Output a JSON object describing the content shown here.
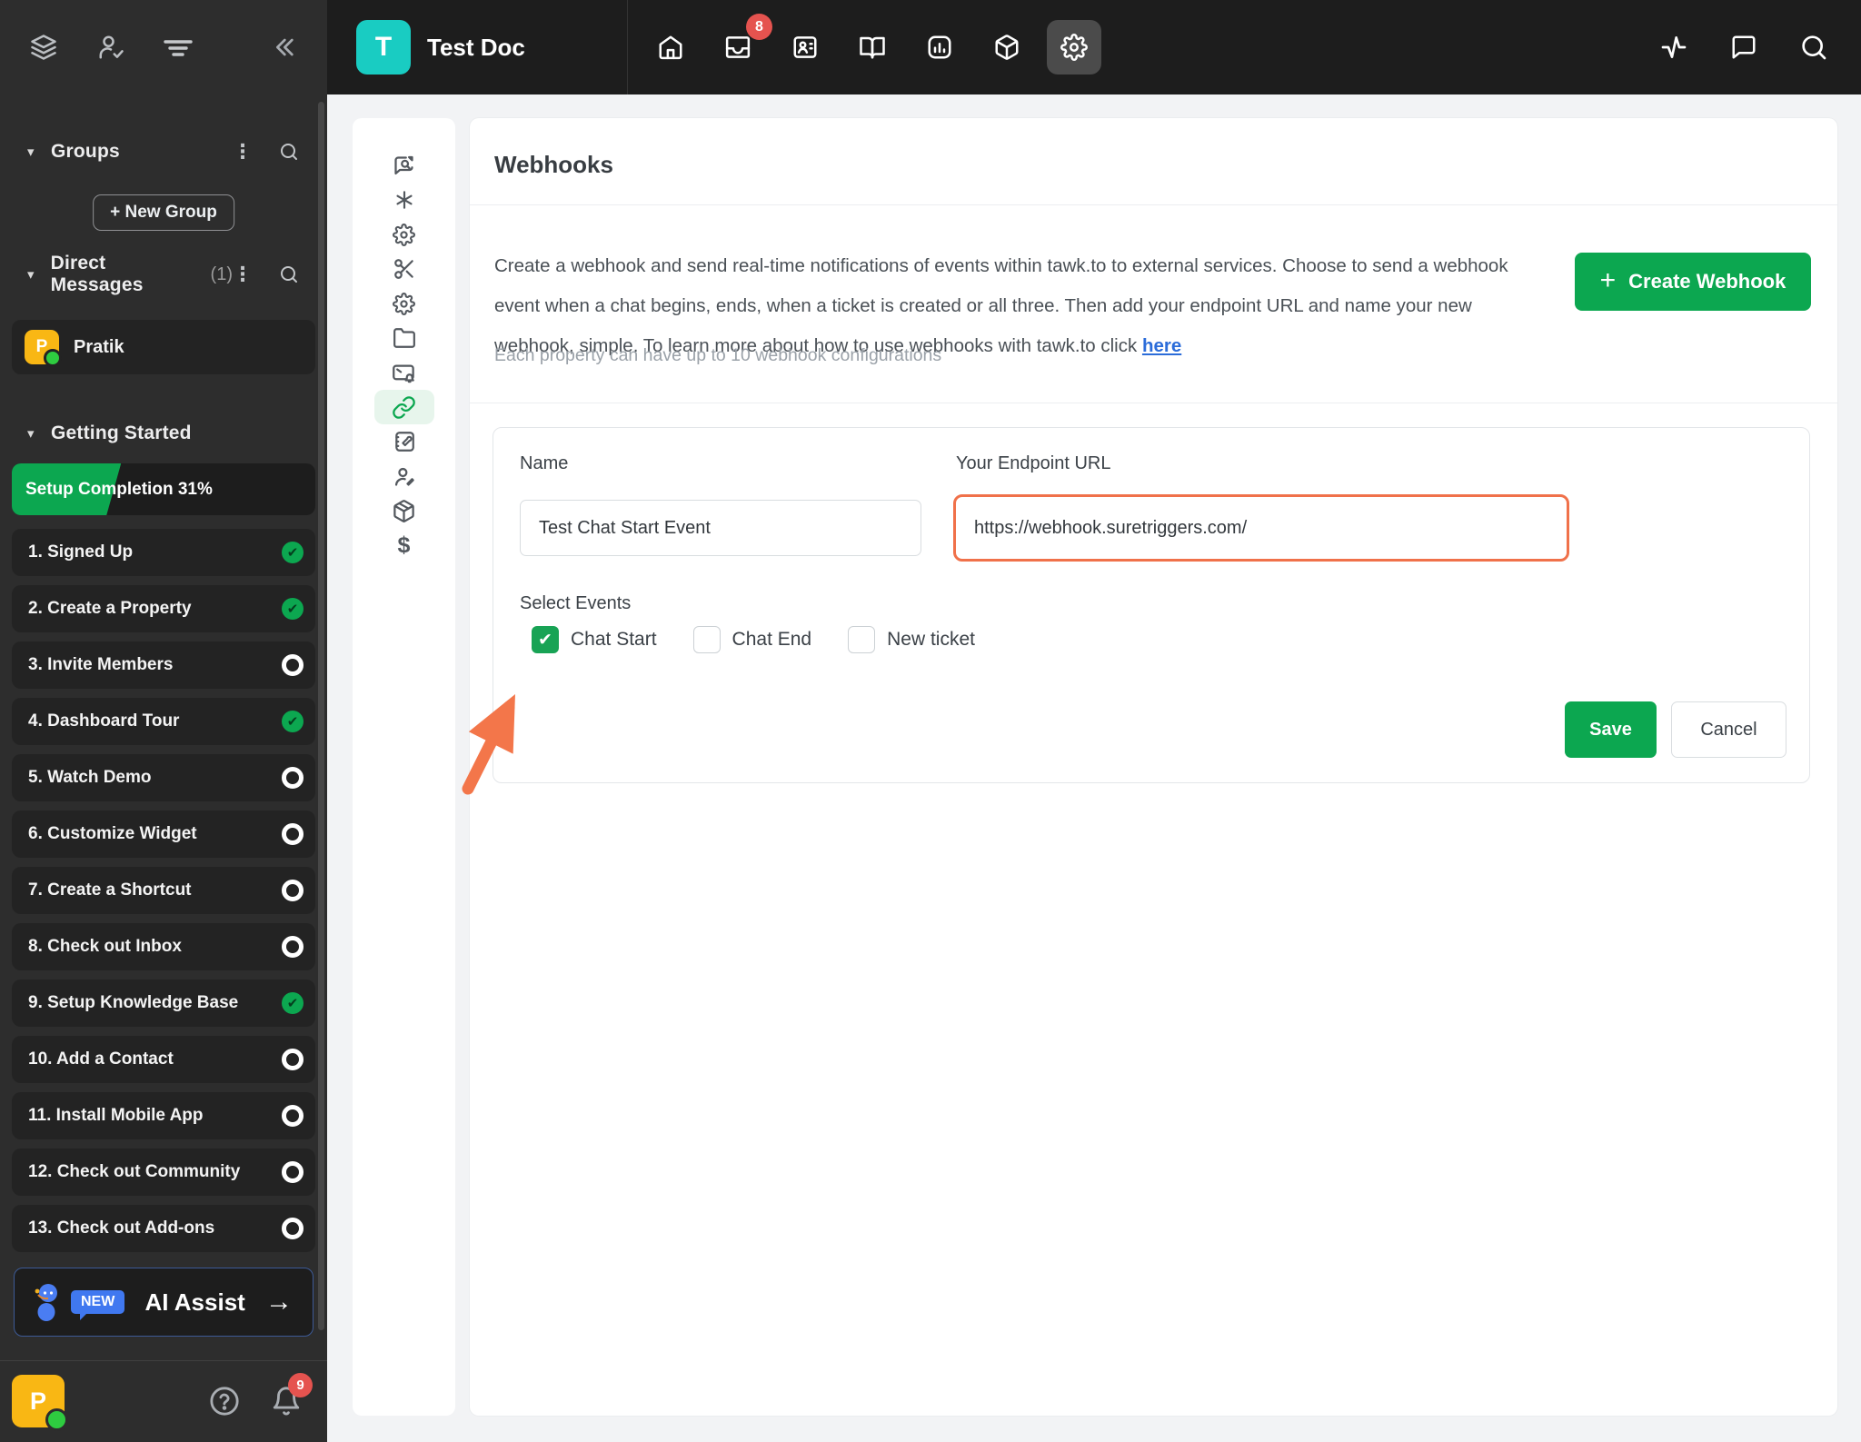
{
  "colors": {
    "accent_green": "#0CA750",
    "teal_brand": "#19CCC2",
    "highlight_orange": "#F0714A",
    "link_blue": "#2B6CD9",
    "badge_red": "#E5534F",
    "new_badge_blue": "#4078F0",
    "avatar_yellow": "#F9B714",
    "sidebar_bg": "#2D2D2D",
    "topbar_bg": "#1D1D1D"
  },
  "sidebar": {
    "header_icons": [
      "layers",
      "agent-check",
      "filter",
      "collapse-double-chevron"
    ],
    "groups": {
      "label": "Groups"
    },
    "new_group_label": "+ New Group",
    "direct_messages": {
      "label": "Direct Messages",
      "count": "(1)"
    },
    "dm_user": {
      "initial": "P",
      "name": "Pratik",
      "status": "online"
    },
    "getting_started": {
      "label": "Getting Started",
      "progress_label": "Setup Completion 31%",
      "progress_pct": 36,
      "items": [
        {
          "label": "1. Signed Up",
          "done": true
        },
        {
          "label": "2. Create a Property",
          "done": true
        },
        {
          "label": "3. Invite Members",
          "done": false
        },
        {
          "label": "4. Dashboard Tour",
          "done": true
        },
        {
          "label": "5. Watch Demo",
          "done": false
        },
        {
          "label": "6. Customize Widget",
          "done": false
        },
        {
          "label": "7. Create a Shortcut",
          "done": false
        },
        {
          "label": "8. Check out Inbox",
          "done": false
        },
        {
          "label": "9. Setup Knowledge Base",
          "done": true
        },
        {
          "label": "10. Add a Contact",
          "done": false
        },
        {
          "label": "11. Install Mobile App",
          "done": false
        },
        {
          "label": "12. Check out Community",
          "done": false
        },
        {
          "label": "13. Check out Add-ons",
          "done": false
        }
      ]
    },
    "ai_assist": {
      "badge": "NEW",
      "label": "AI Assist",
      "arrow": "→"
    },
    "footer": {
      "avatar_initial": "P",
      "notification_count": "9",
      "icons": [
        "help",
        "bell"
      ]
    }
  },
  "topbar": {
    "property_initial": "T",
    "property_name": "Test Doc",
    "inbox_badge": "8",
    "nav_icons": [
      "home",
      "inbox",
      "contacts",
      "knowledge-base",
      "reports",
      "add-ons",
      "settings"
    ],
    "active_icon": "settings",
    "right_icons": [
      "activity",
      "chat",
      "search"
    ]
  },
  "settings_nav": {
    "icons": [
      "chat-search",
      "asterisk",
      "gear",
      "scissors",
      "gear-widget",
      "folder",
      "mail-bell",
      "webhooks-link",
      "notebook-tools",
      "agent-edit",
      "package-box",
      "dollar"
    ],
    "active": "webhooks-link",
    "dollar_glyph": "$"
  },
  "main": {
    "title": "Webhooks",
    "description_before_link": "Create a webhook and send real-time notifications of events within tawk.to to external services. Choose to send a webhook event when a chat begins, ends, when a ticket is created or all three. Then add your endpoint URL and name your new webhook, simple. To learn more about how to use webhooks with tawk.to click ",
    "description_link": "here",
    "limit_note": "Each property can have up to 10 webhook configurations",
    "create_button": "Create Webhook",
    "form": {
      "name_label": "Name",
      "name_value": "Test Chat Start Event",
      "url_label": "Your Endpoint URL",
      "url_value": "https://webhook.suretriggers.com/",
      "events_label": "Select Events",
      "events": [
        {
          "label": "Chat Start",
          "checked": true
        },
        {
          "label": "Chat End",
          "checked": false
        },
        {
          "label": "New ticket",
          "checked": false
        }
      ],
      "save_label": "Save",
      "cancel_label": "Cancel"
    }
  }
}
